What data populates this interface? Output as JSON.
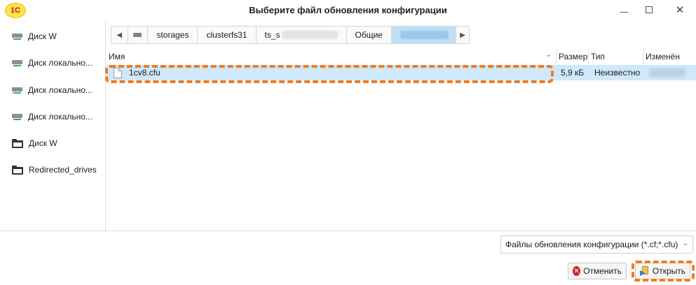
{
  "window": {
    "title": "Выберите файл обновления конфигурации",
    "logo_text": "1С"
  },
  "sidebar": {
    "items": [
      {
        "label": "Диск W",
        "icon": "drive-icon"
      },
      {
        "label": "Диск локально...",
        "icon": "drive-icon"
      },
      {
        "label": "Диск локально...",
        "icon": "drive-icon"
      },
      {
        "label": "Диск локально...",
        "icon": "drive-icon"
      },
      {
        "label": "Диск W",
        "icon": "folder-icon"
      },
      {
        "label": "Redirected_drives",
        "icon": "folder-icon"
      }
    ]
  },
  "breadcrumb": {
    "items": [
      "storages",
      "clusterfs31",
      "ts_s",
      "Общие"
    ]
  },
  "filelist": {
    "columns": [
      "Имя",
      "Размер",
      "Тип",
      "Изменён"
    ],
    "rows": [
      {
        "name": "1cv8.cfu",
        "size": "5,9 кБ",
        "type": "Неизвестно",
        "selected": true
      }
    ]
  },
  "filter": {
    "selected": "Файлы обновления конфигурации (*.cf;*.cfu)"
  },
  "buttons": {
    "cancel": "Отменить",
    "open": "Открыть"
  },
  "colors": {
    "selection": "#cfe8fb",
    "highlight": "#ef7d22",
    "active_crumb": "#bfe0f8"
  }
}
